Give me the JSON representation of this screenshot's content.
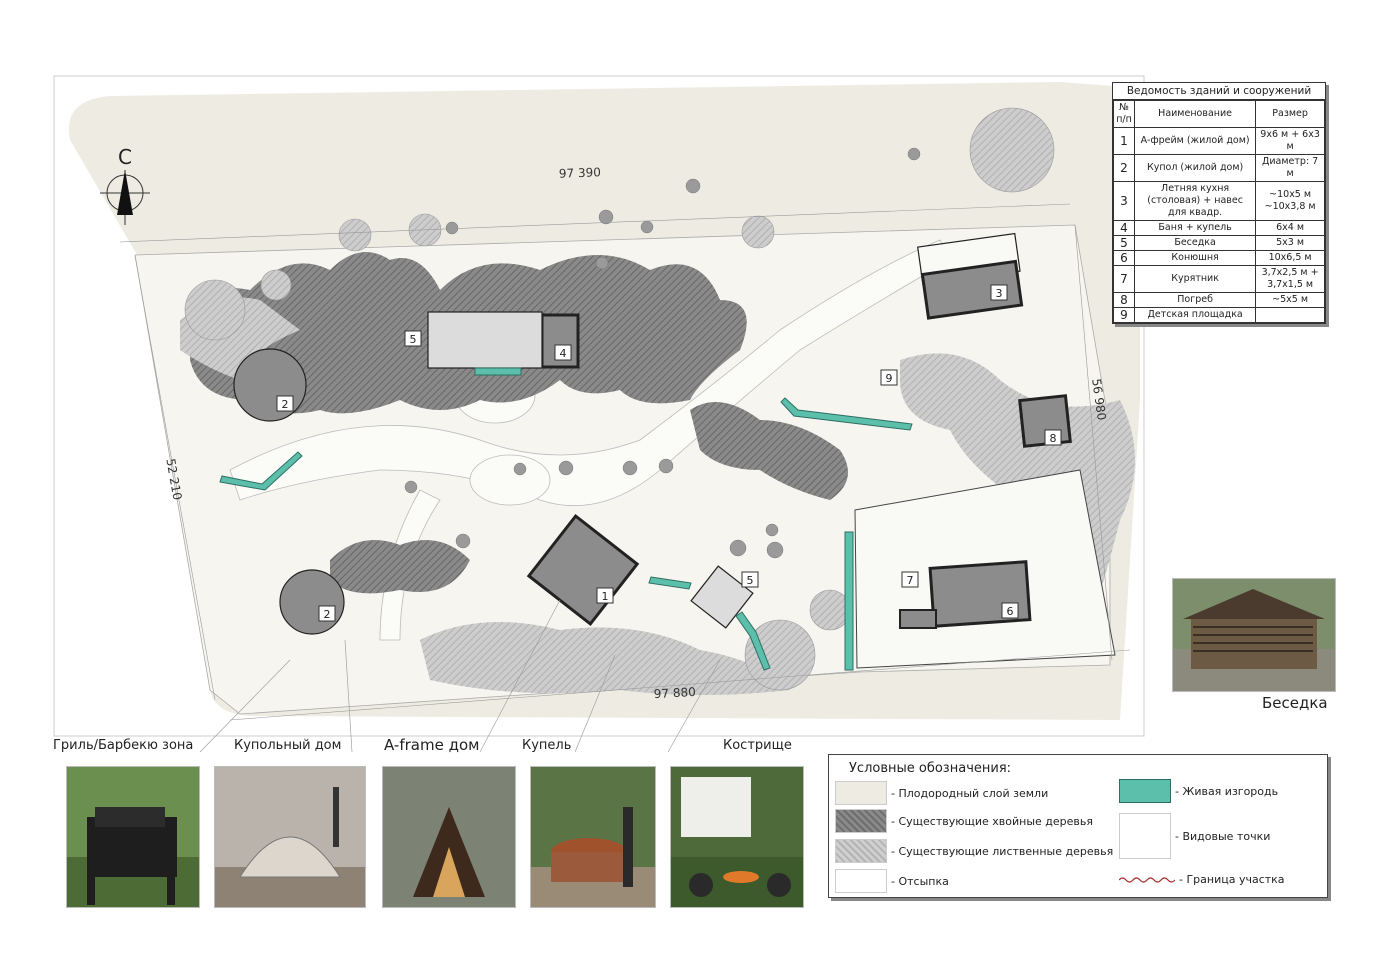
{
  "plan": {
    "north": "С",
    "dimensions": {
      "top": "97 390",
      "bottom": "97 880",
      "left": "52 210",
      "right": "56 980"
    },
    "building_labels": [
      "1",
      "2",
      "2",
      "3",
      "4",
      "5",
      "5",
      "6",
      "7",
      "8",
      "9"
    ]
  },
  "schedule": {
    "title": "Ведомость зданий и сооружений",
    "headers": [
      "№ п/п",
      "Наименование",
      "Размер"
    ],
    "rows": [
      {
        "n": "1",
        "name": "А-фрейм (жилой дом)",
        "size": "9х6 м + 6х3 м"
      },
      {
        "n": "2",
        "name": "Купол (жилой дом)",
        "size": "Диаметр: 7 м"
      },
      {
        "n": "3",
        "name": "Летняя кухня (столовая) + навес для квадр.",
        "size": "~10х5 м ~10х3,8 м"
      },
      {
        "n": "4",
        "name": "Баня + купель",
        "size": "6х4 м"
      },
      {
        "n": "5",
        "name": "Беседка",
        "size": "5х3 м"
      },
      {
        "n": "6",
        "name": "Конюшня",
        "size": "10х6,5 м"
      },
      {
        "n": "7",
        "name": "Курятник",
        "size": "3,7х2,5 м + 3,7х1,5 м"
      },
      {
        "n": "8",
        "name": "Погреб",
        "size": "~5х5 м"
      },
      {
        "n": "9",
        "name": "Детская площадка",
        "size": ""
      }
    ]
  },
  "photos": {
    "grill": "Гриль/Барбекю зона",
    "dome": "Купольный дом",
    "aframe": "A-frame дом",
    "tub": "Купель",
    "fire": "Кострище",
    "gazebo": "Беседка"
  },
  "legend": {
    "title": "Условные обозначения:",
    "fertile": "- Плодородный слой земли",
    "conifers": "- Существующие хвойные деревья",
    "deciduous": "- Существующие лиственные деревья",
    "gravel": "- Отсыпка",
    "hedge": "- Живая изгородь",
    "viewpoints": "- Видовые точки",
    "boundary": "- Граница участка"
  },
  "colors": {
    "hedge": "#5bbfab",
    "conifer": "#7a7a7a",
    "deciduous": "#c2c2c2",
    "soil": "#eeece2"
  }
}
